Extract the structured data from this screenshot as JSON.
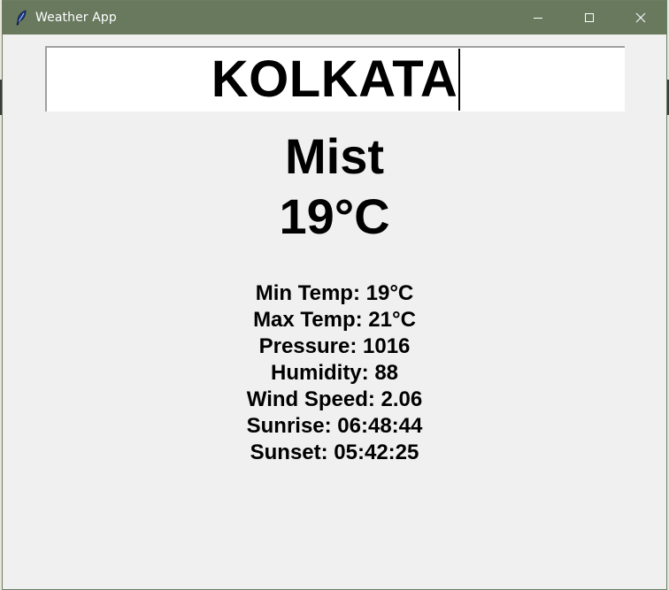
{
  "window": {
    "title": "Weather App",
    "icon": "feather-icon",
    "controls": [
      "minimize-icon",
      "maximize-icon",
      "close-icon"
    ]
  },
  "city_input": {
    "value": "KOLKATA"
  },
  "weather": {
    "condition": "Mist",
    "temperature": "19°C"
  },
  "details": [
    "Min Temp: 19°C",
    "Max Temp: 21°C",
    "Pressure: 1016",
    "Humidity: 88",
    "Wind Speed: 2.06",
    "Sunrise: 06:48:44",
    "Sunset: 05:42:25"
  ],
  "colors": {
    "titlebar": "#68795e",
    "window_bg": "#f0f0f0",
    "input_bg": "#ffffff",
    "text": "#000000"
  }
}
